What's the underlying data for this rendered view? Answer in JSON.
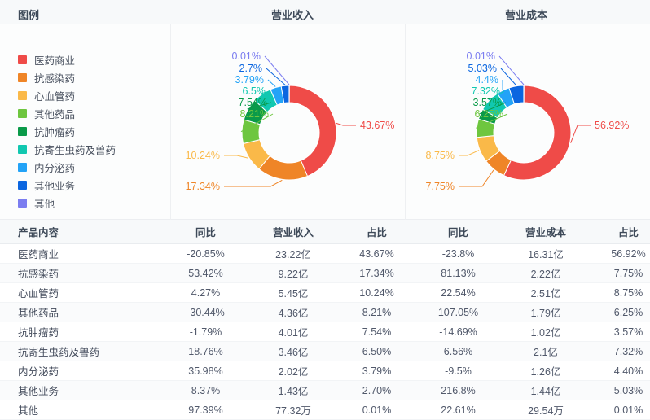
{
  "header": {
    "legend_title": "图例",
    "chart1_title": "营业收入",
    "chart2_title": "营业成本"
  },
  "legend": {
    "items": [
      {
        "label": "医药商业",
        "color": "#ef4b48"
      },
      {
        "label": "抗感染药",
        "color": "#ef8527"
      },
      {
        "label": "心血管药",
        "color": "#fab949"
      },
      {
        "label": "其他药品",
        "color": "#6ec63f"
      },
      {
        "label": "抗肿瘤药",
        "color": "#0a9a49"
      },
      {
        "label": "抗寄生虫药及兽药",
        "color": "#11c8b0"
      },
      {
        "label": "内分泌药",
        "color": "#23a3f7"
      },
      {
        "label": "其他业务",
        "color": "#0b66e0"
      },
      {
        "label": "其他",
        "color": "#7b7df0"
      }
    ]
  },
  "chart_data": [
    {
      "type": "pie",
      "title": "营业收入",
      "legend_position": "left",
      "categories": [
        "医药商业",
        "抗感染药",
        "心血管药",
        "其他药品",
        "抗肿瘤药",
        "抗寄生虫药及兽药",
        "内分泌药",
        "其他业务",
        "其他"
      ],
      "values": [
        43.67,
        17.34,
        10.24,
        8.21,
        7.54,
        6.5,
        3.79,
        2.7,
        0.01
      ],
      "labels": [
        "43.67%",
        "17.34%",
        "10.24%",
        "8.21%",
        "7.54%",
        "6.5%",
        "3.79%",
        "2.7%",
        "0.01%"
      ],
      "colors": [
        "#ef4b48",
        "#ef8527",
        "#fab949",
        "#6ec63f",
        "#0a9a49",
        "#11c8b0",
        "#23a3f7",
        "#0b66e0",
        "#7b7df0"
      ],
      "unit": "%"
    },
    {
      "type": "pie",
      "title": "营业成本",
      "legend_position": "left",
      "categories": [
        "医药商业",
        "抗感染药",
        "心血管药",
        "其他药品",
        "抗肿瘤药",
        "抗寄生虫药及兽药",
        "内分泌药",
        "其他业务",
        "其他"
      ],
      "values": [
        56.92,
        7.75,
        8.75,
        6.25,
        3.57,
        7.32,
        4.4,
        5.03,
        0.01
      ],
      "labels": [
        "56.92%",
        "7.75%",
        "8.75%",
        "6.25%",
        "3.57%",
        "7.32%",
        "4.4%",
        "5.03%",
        "0.01%"
      ],
      "colors": [
        "#ef4b48",
        "#ef8527",
        "#fab949",
        "#6ec63f",
        "#0a9a49",
        "#11c8b0",
        "#23a3f7",
        "#0b66e0",
        "#7b7df0"
      ],
      "unit": "%"
    }
  ],
  "table": {
    "columns": [
      "产品内容",
      "同比",
      "营业收入",
      "占比",
      "同比",
      "营业成本",
      "占比"
    ],
    "rows": [
      {
        "name": "医药商业",
        "rev_yoy": "-20.85%",
        "rev_yoy_dir": "down",
        "revenue": "23.22亿",
        "rev_share": "43.67%",
        "cost_yoy": "-23.8%",
        "cost_yoy_dir": "down",
        "cost": "16.31亿",
        "cost_share": "56.92%"
      },
      {
        "name": "抗感染药",
        "rev_yoy": "53.42%",
        "rev_yoy_dir": "up",
        "revenue": "9.22亿",
        "rev_share": "17.34%",
        "cost_yoy": "81.13%",
        "cost_yoy_dir": "up",
        "cost": "2.22亿",
        "cost_share": "7.75%"
      },
      {
        "name": "心血管药",
        "rev_yoy": "4.27%",
        "rev_yoy_dir": "up",
        "revenue": "5.45亿",
        "rev_share": "10.24%",
        "cost_yoy": "22.54%",
        "cost_yoy_dir": "up",
        "cost": "2.51亿",
        "cost_share": "8.75%"
      },
      {
        "name": "其他药品",
        "rev_yoy": "-30.44%",
        "rev_yoy_dir": "down",
        "revenue": "4.36亿",
        "rev_share": "8.21%",
        "cost_yoy": "107.05%",
        "cost_yoy_dir": "up",
        "cost": "1.79亿",
        "cost_share": "6.25%"
      },
      {
        "name": "抗肿瘤药",
        "rev_yoy": "-1.79%",
        "rev_yoy_dir": "down",
        "revenue": "4.01亿",
        "rev_share": "7.54%",
        "cost_yoy": "-14.69%",
        "cost_yoy_dir": "down",
        "cost": "1.02亿",
        "cost_share": "3.57%"
      },
      {
        "name": "抗寄生虫药及兽药",
        "rev_yoy": "18.76%",
        "rev_yoy_dir": "up",
        "revenue": "3.46亿",
        "rev_share": "6.50%",
        "cost_yoy": "6.56%",
        "cost_yoy_dir": "up",
        "cost": "2.1亿",
        "cost_share": "7.32%"
      },
      {
        "name": "内分泌药",
        "rev_yoy": "35.98%",
        "rev_yoy_dir": "up",
        "revenue": "2.02亿",
        "rev_share": "3.79%",
        "cost_yoy": "-9.5%",
        "cost_yoy_dir": "down",
        "cost": "1.26亿",
        "cost_share": "4.40%"
      },
      {
        "name": "其他业务",
        "rev_yoy": "8.37%",
        "rev_yoy_dir": "up",
        "revenue": "1.43亿",
        "rev_share": "2.70%",
        "cost_yoy": "216.8%",
        "cost_yoy_dir": "up",
        "cost": "1.44亿",
        "cost_share": "5.03%"
      },
      {
        "name": "其他",
        "rev_yoy": "97.39%",
        "rev_yoy_dir": "up",
        "revenue": "77.32万",
        "rev_share": "0.01%",
        "cost_yoy": "22.61%",
        "cost_yoy_dir": "up",
        "cost": "29.54万",
        "cost_share": "0.01%"
      }
    ]
  },
  "colors": {
    "up": "#e23c39",
    "down": "#18a05a"
  }
}
